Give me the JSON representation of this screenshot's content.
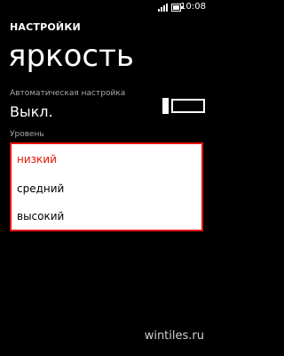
{
  "status_bar": {
    "time": "10:08",
    "icons": [
      "signal-icon",
      "battery-icon"
    ]
  },
  "header": {
    "section": "НАСТРОЙКИ",
    "title": "яркость"
  },
  "auto_setting": {
    "label": "Автоматическая настройка",
    "value": "Выкл.",
    "toggle_on": false
  },
  "level": {
    "label": "Уровень",
    "options": [
      {
        "label": "низкий",
        "selected": true
      },
      {
        "label": "средний",
        "selected": false
      },
      {
        "label": "высокий",
        "selected": false
      }
    ]
  },
  "watermark": "wintiles.ru",
  "colors": {
    "accent": "#e51400",
    "background": "#000000",
    "secondary_text": "#a8a8a8"
  }
}
